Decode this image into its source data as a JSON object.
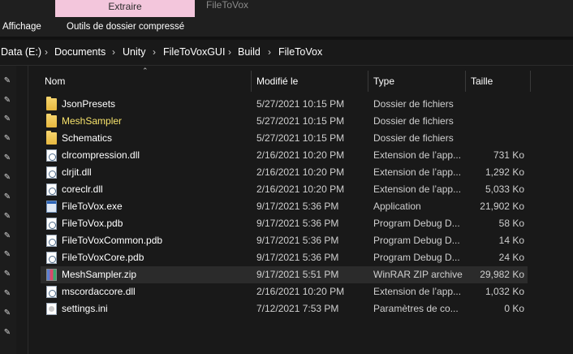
{
  "ribbon": {
    "context_tab": "Extraire",
    "window_title": "FileToVox",
    "tabs": [
      "Affichage",
      "Outils de dossier compressé"
    ]
  },
  "breadcrumb": [
    "Data (E:)",
    "Documents",
    "Unity",
    "FileToVoxGUI",
    "Build",
    "FileToVox"
  ],
  "columns": {
    "name": "Nom",
    "modified": "Modifié le",
    "type": "Type",
    "size": "Taille"
  },
  "files": [
    {
      "name": "JsonPresets",
      "modified": "5/27/2021 10:15 PM",
      "type": "Dossier de fichiers",
      "size": "",
      "icon": "folder-icon"
    },
    {
      "name": "MeshSampler",
      "modified": "5/27/2021 10:15 PM",
      "type": "Dossier de fichiers",
      "size": "",
      "icon": "folder-icon"
    },
    {
      "name": "Schematics",
      "modified": "5/27/2021 10:15 PM",
      "type": "Dossier de fichiers",
      "size": "",
      "icon": "folder-icon"
    },
    {
      "name": "clrcompression.dll",
      "modified": "2/16/2021 10:20 PM",
      "type": "Extension de l’app...",
      "size": "731 Ko",
      "icon": "dll-icon"
    },
    {
      "name": "clrjit.dll",
      "modified": "2/16/2021 10:20 PM",
      "type": "Extension de l’app...",
      "size": "1,292 Ko",
      "icon": "dll-icon"
    },
    {
      "name": "coreclr.dll",
      "modified": "2/16/2021 10:20 PM",
      "type": "Extension de l’app...",
      "size": "5,033 Ko",
      "icon": "dll-icon"
    },
    {
      "name": "FileToVox.exe",
      "modified": "9/17/2021 5:36 PM",
      "type": "Application",
      "size": "21,902 Ko",
      "icon": "exe-icon"
    },
    {
      "name": "FileToVox.pdb",
      "modified": "9/17/2021 5:36 PM",
      "type": "Program Debug D...",
      "size": "58 Ko",
      "icon": "pdb-icon"
    },
    {
      "name": "FileToVoxCommon.pdb",
      "modified": "9/17/2021 5:36 PM",
      "type": "Program Debug D...",
      "size": "14 Ko",
      "icon": "pdb-icon"
    },
    {
      "name": "FileToVoxCore.pdb",
      "modified": "9/17/2021 5:36 PM",
      "type": "Program Debug D...",
      "size": "24 Ko",
      "icon": "pdb-icon"
    },
    {
      "name": "MeshSampler.zip",
      "modified": "9/17/2021 5:51 PM",
      "type": "WinRAR ZIP archive",
      "size": "29,982 Ko",
      "icon": "zip-icon"
    },
    {
      "name": "mscordaccore.dll",
      "modified": "2/16/2021 10:20 PM",
      "type": "Extension de l’app...",
      "size": "1,032 Ko",
      "icon": "dll-icon"
    },
    {
      "name": "settings.ini",
      "modified": "7/12/2021 7:53 PM",
      "type": "Paramètres de co...",
      "size": "0 Ko",
      "icon": "ini-icon"
    }
  ],
  "colors": {
    "context_tab": "#f3c6dc",
    "highlight_name": "#f7e36b",
    "background": "#191919"
  }
}
